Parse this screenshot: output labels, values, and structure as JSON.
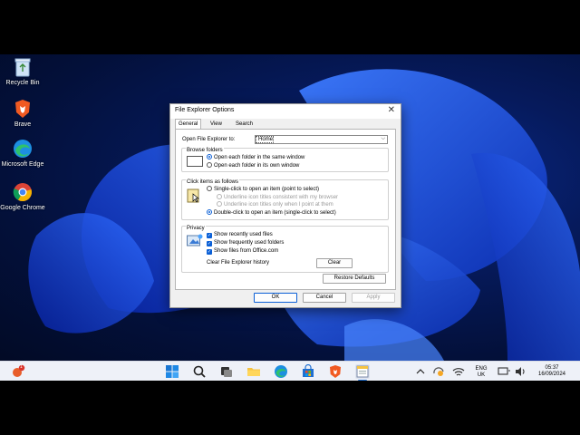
{
  "desktop": {
    "icons": [
      {
        "label": "Recycle Bin",
        "icon": "recycle-bin-icon"
      },
      {
        "label": "Brave",
        "icon": "brave-icon"
      },
      {
        "label": "Microsoft Edge",
        "icon": "edge-icon"
      },
      {
        "label": "Google Chrome",
        "icon": "chrome-icon"
      }
    ]
  },
  "dialog": {
    "title": "File Explorer Options",
    "close": "✕",
    "tabs": [
      "General",
      "View",
      "Search"
    ],
    "active_tab": "General",
    "open_label": "Open File Explorer to:",
    "open_value": "Home",
    "browse": {
      "legend": "Browse folders",
      "options": [
        "Open each folder in the same window",
        "Open each folder in its own window"
      ],
      "selected": 0
    },
    "click": {
      "legend": "Click items as follows",
      "single": "Single-click to open an item (point to select)",
      "underline_consistent": "Underline icon titles consistent with my browser",
      "underline_point": "Underline icon titles only when I point at them",
      "double": "Double-click to open an item (single-click to select)",
      "selected": "double"
    },
    "privacy": {
      "legend": "Privacy",
      "items": [
        "Show recently used files",
        "Show frequently used folders",
        "Show files from Office.com"
      ],
      "clear_label": "Clear File Explorer history",
      "clear_button": "Clear"
    },
    "restore_button": "Restore Defaults",
    "ok": "OK",
    "cancel": "Cancel",
    "apply": "Apply"
  },
  "taskbar": {
    "lang_top": "ENG",
    "lang_bottom": "UK",
    "time": "05:37",
    "date": "16/09/2024",
    "weather_badge": "1"
  }
}
